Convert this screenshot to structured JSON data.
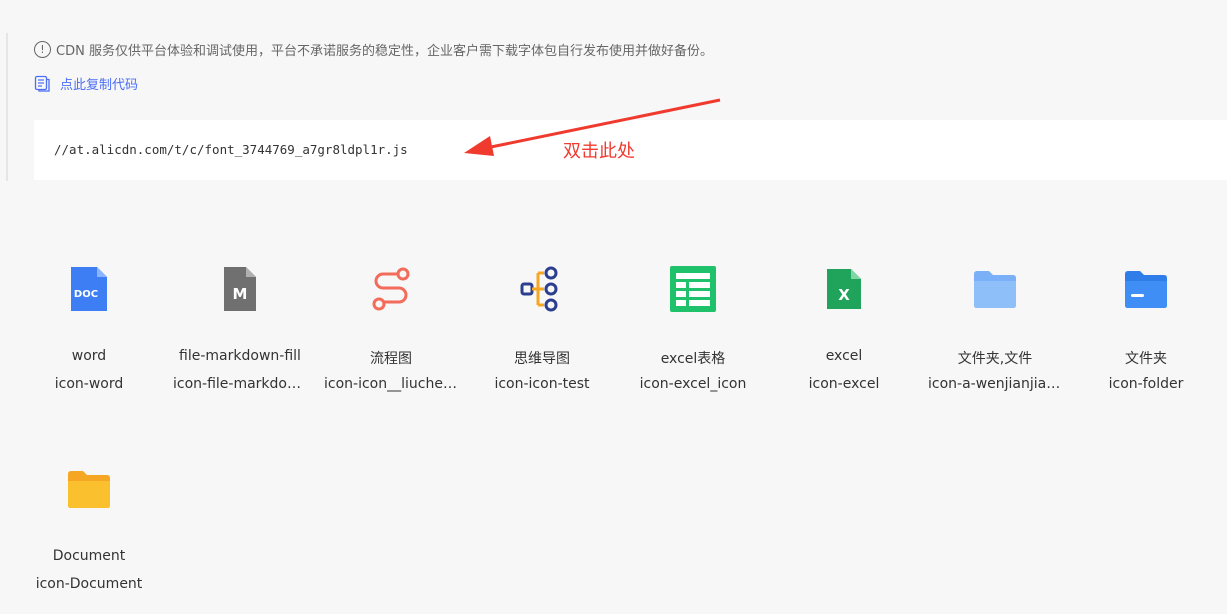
{
  "notice": {
    "info_glyph": "!",
    "text": "CDN 服务仅供平台体验和调试使用，平台不承诺服务的稳定性，企业客户需下载字体包自行发布使用并做好备份。"
  },
  "copy_link": {
    "label": "点此复制代码"
  },
  "code": {
    "url": "//at.alicdn.com/t/c/font_3744769_a7gr8ldpl1r.js"
  },
  "annotation": {
    "label": "双击此处",
    "color": "#f03a2e"
  },
  "colors": {
    "link": "#4c6ef5",
    "word": "#3d7ef5",
    "markdown": "#707070",
    "flowchart": "#f26b5b",
    "mindmap": "#2c3e8f",
    "mindmap_accent": "#f5a623",
    "excel_table": "#1fc16b",
    "excel": "#20a45b",
    "folder_light": "#79b0f7",
    "folder_blue": "#3f8ef5",
    "folder_yellow": "#fbc02d"
  },
  "icons": [
    {
      "name": "word",
      "code": "icon-word",
      "icon": "word-doc-icon",
      "glyph": "DOC"
    },
    {
      "name": "file-markdown-fill",
      "code": "icon-file-markdown-fill",
      "icon": "markdown-file-icon",
      "glyph": "M"
    },
    {
      "name": "流程图",
      "code": "icon-icon__liucheng",
      "icon": "flowchart-icon"
    },
    {
      "name": "思维导图",
      "code": "icon-icon-test",
      "icon": "mindmap-icon"
    },
    {
      "name": "excel表格",
      "code": "icon-excel_icon",
      "icon": "excel-table-icon"
    },
    {
      "name": "excel",
      "code": "icon-excel",
      "icon": "excel-icon",
      "glyph": "X"
    },
    {
      "name": "文件夹,文件",
      "code": "icon-a-wenjianjiawenjian",
      "icon": "folder-file-icon"
    },
    {
      "name": "文件夹",
      "code": "icon-folder",
      "icon": "folder-icon"
    },
    {
      "name": "Document",
      "code": "icon-Document",
      "icon": "document-folder-icon"
    }
  ]
}
